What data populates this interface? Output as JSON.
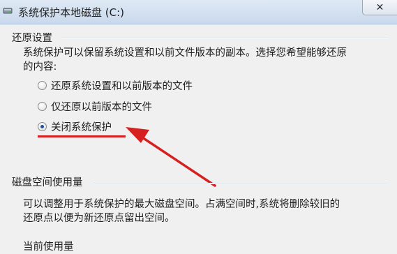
{
  "window": {
    "title": "系统保护本地磁盘 (C:)",
    "close_glyph": "✕"
  },
  "restore_settings": {
    "heading": "还原设置",
    "description_line1": "系统保护可以保留系统设置和以前文件版本的副本。选择您希望能够还原",
    "description_line2": "的内容:",
    "options": [
      {
        "label": "还原系统设置和以前版本的文件",
        "checked": false
      },
      {
        "label": "仅还原以前版本的文件",
        "checked": false
      },
      {
        "label": "关闭系统保护",
        "checked": true
      }
    ]
  },
  "disk_usage": {
    "heading": "磁盘空间使用量",
    "description_line1": "可以调整用于系统保护的最大磁盘空间。占满空间时,系统将删除较旧的",
    "description_line2": "还原点以便为新还原点留出空间。",
    "current_usage_label": "当前使用量"
  },
  "colors": {
    "annotation_red": "#d62020",
    "radio_dot": "#1d4e9e"
  },
  "icons": {
    "window_icon": "drive-icon",
    "annotation": "red-arrow-icon"
  }
}
